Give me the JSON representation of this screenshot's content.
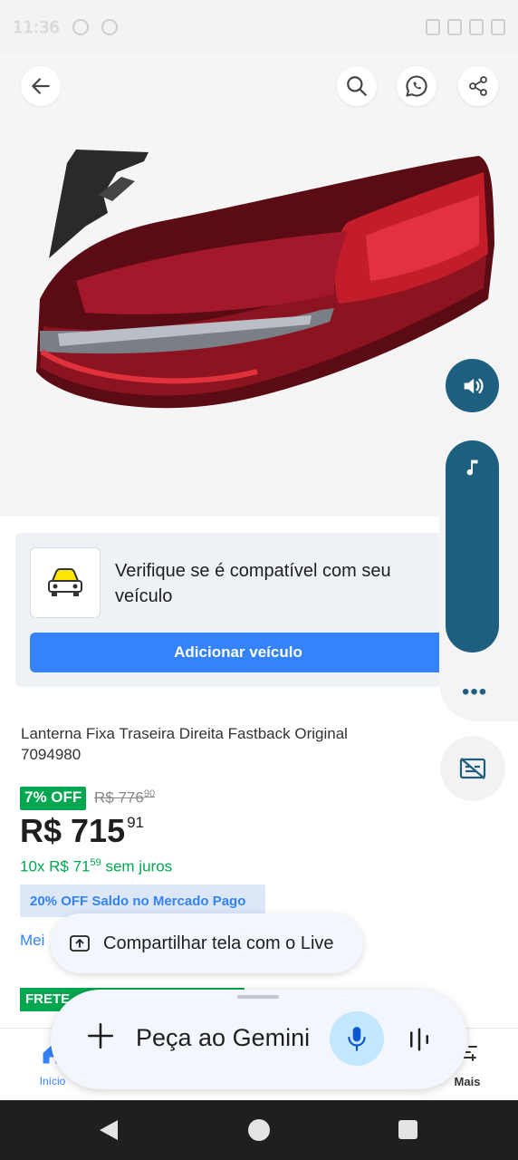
{
  "status_bar": {
    "time": "11:36"
  },
  "top_actions": {
    "back_icon": "arrow-left-icon",
    "search_icon": "search-icon",
    "whatsapp_icon": "whatsapp-icon",
    "share_icon": "share-icon"
  },
  "compat_card": {
    "text": "Verifique se é compatível com seu veículo",
    "button_label": "Adicionar veículo"
  },
  "product": {
    "title": "Lanterna Fixa Traseira Direita Fastback Original 7094980",
    "discount_badge": "7% OFF",
    "old_price_main": "R$ 776",
    "old_price_cents": "90",
    "price_main": "R$ 715",
    "price_cents": "91",
    "installments_prefix": "10x R$ 71",
    "installments_cents": "59",
    "installments_suffix": " sem juros",
    "mp_badge": "20% OFF Saldo no Mercado Pago",
    "payment_link": "Mei",
    "shipping_badge": "FRETE"
  },
  "bottom_nav": {
    "home_label": "Início",
    "more_label": "Mais"
  },
  "live_share": {
    "label": "Compartilhar tela com o Live"
  },
  "gemini": {
    "placeholder": "Peça ao Gemini"
  },
  "colors": {
    "brand_blue": "#3483fa",
    "green": "#00a650",
    "side_teal": "#1e5f80",
    "gemini_mic_bg": "#c3e7ff"
  }
}
